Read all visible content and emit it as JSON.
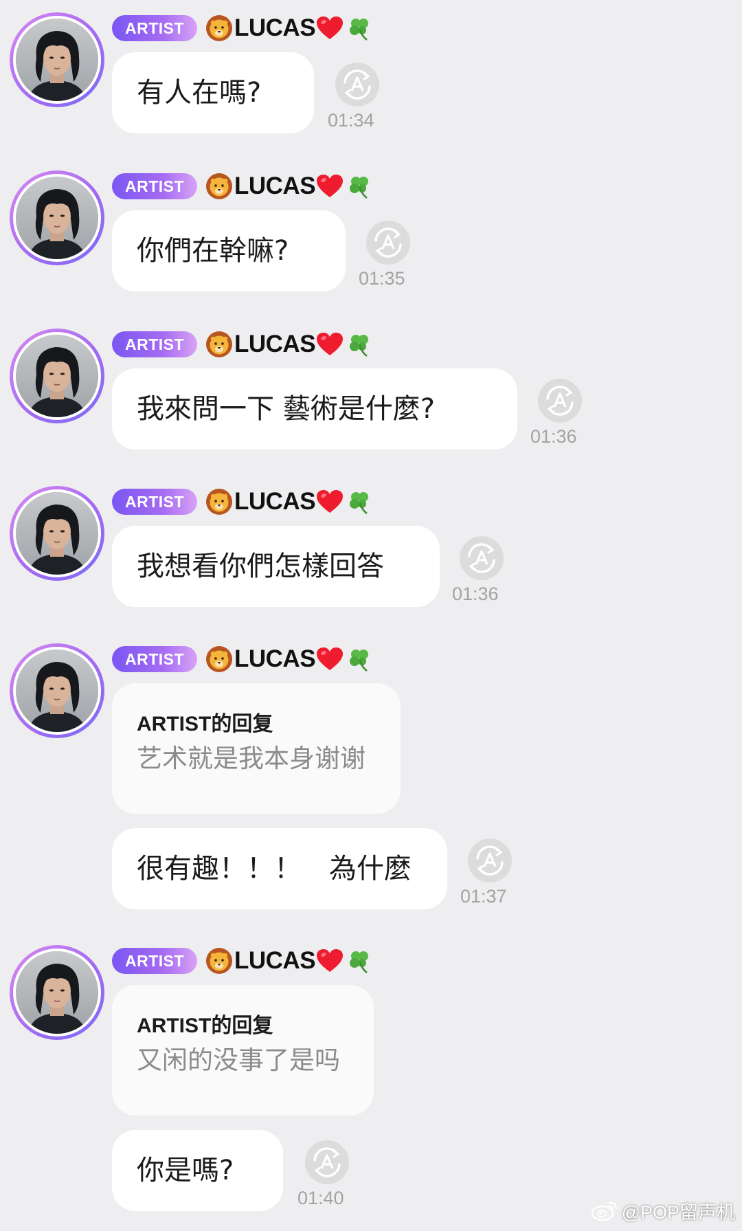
{
  "sender": {
    "badge": "ARTIST",
    "name": "LUCAS",
    "name_emojis": [
      "lion-face-icon",
      "red-heart-icon",
      "shamrock-icon"
    ],
    "badge_gradient": [
      "#7a56f3",
      "#d8a2f6"
    ],
    "avatar_ring_gradient": [
      "#d98af0",
      "#7a6cf7"
    ]
  },
  "messages": [
    {
      "text": "有人在嗎?",
      "time": "01:34"
    },
    {
      "text": "你們在幹嘛?",
      "time": "01:35"
    },
    {
      "text": "我來問一下 藝術是什麼?",
      "time": "01:36"
    },
    {
      "text": "我想看你們怎樣回答",
      "time": "01:36"
    },
    {
      "reply_title": "ARTIST的回复",
      "reply_text": "艺术就是我本身谢谢",
      "text": "很有趣！！！　為什麼",
      "time": "01:37"
    },
    {
      "reply_title": "ARTIST的回复",
      "reply_text": "又闲的没事了是吗",
      "text": "你是嗎?",
      "time": "01:40"
    }
  ],
  "watermark": "@POP留声机",
  "colors": {
    "background": "#eeeef0",
    "bubble": "#ffffff",
    "reply_bubble": "#fafafa",
    "time_text": "#a3a3a3",
    "reply_text": "#8b8b8b"
  }
}
